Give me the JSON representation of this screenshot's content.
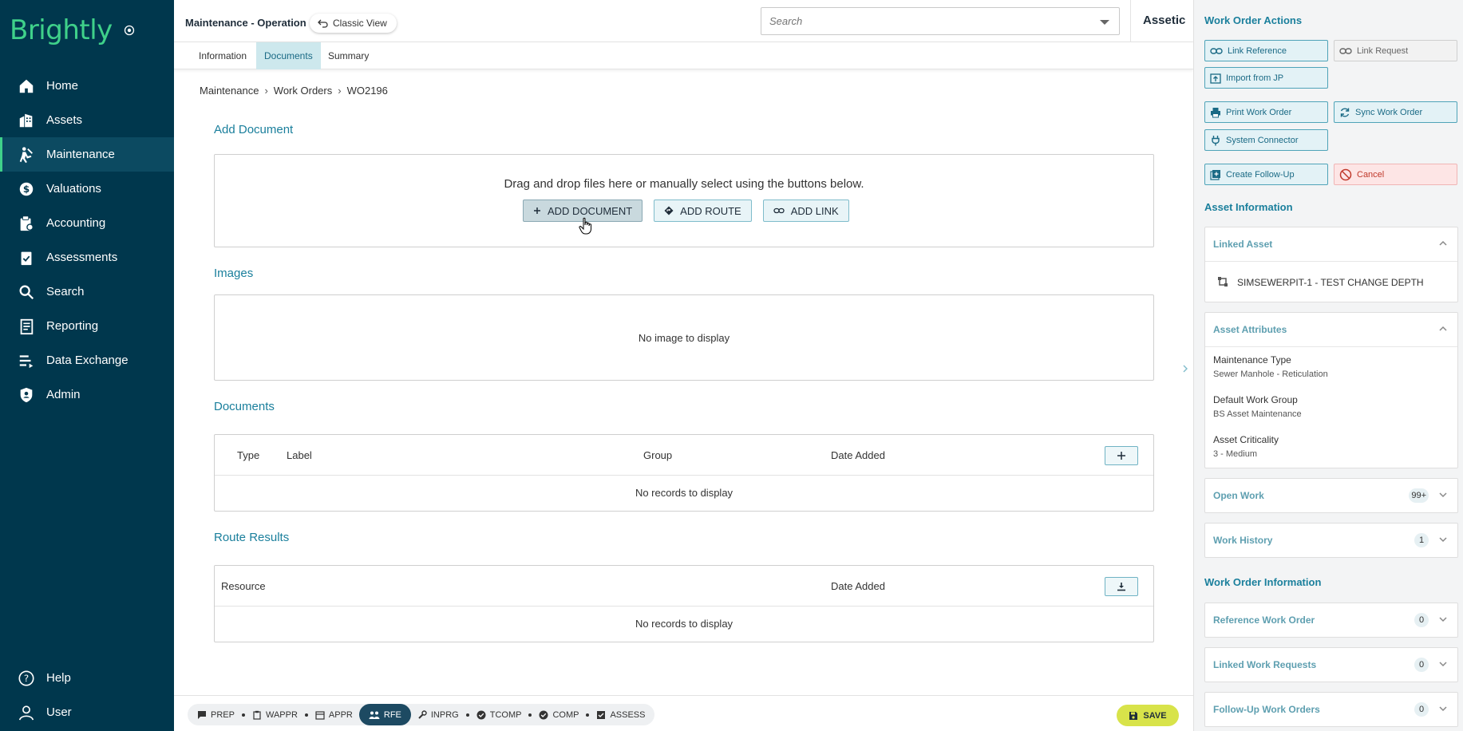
{
  "brand": {
    "logo_text": "Brightly"
  },
  "sidebar": {
    "items": [
      {
        "label": "Home",
        "icon": "home-icon"
      },
      {
        "label": "Assets",
        "icon": "building-icon"
      },
      {
        "label": "Maintenance",
        "icon": "worker-icon",
        "active": true
      },
      {
        "label": "Valuations",
        "icon": "dollar-globe-icon"
      },
      {
        "label": "Accounting",
        "icon": "ledger-icon"
      },
      {
        "label": "Assessments",
        "icon": "clipboard-check-icon"
      },
      {
        "label": "Search",
        "icon": "search-icon"
      },
      {
        "label": "Reporting",
        "icon": "report-icon"
      },
      {
        "label": "Data Exchange",
        "icon": "data-exchange-icon"
      },
      {
        "label": "Admin",
        "icon": "shield-user-icon"
      }
    ],
    "bottom": [
      {
        "label": "Help",
        "icon": "help-icon"
      },
      {
        "label": "User",
        "icon": "user-icon"
      }
    ]
  },
  "header": {
    "title": "Maintenance - Operation",
    "classic_view": "Classic View",
    "search_placeholder": "Search",
    "tenant": "Assetic"
  },
  "tabs": [
    {
      "label": "Information"
    },
    {
      "label": "Documents",
      "active": true
    },
    {
      "label": "Summary"
    }
  ],
  "breadcrumb": [
    "Maintenance",
    "Work Orders",
    "WO2196"
  ],
  "add_document": {
    "title": "Add Document",
    "instructions": "Drag and drop files here or manually select using the buttons below.",
    "buttons": {
      "add_document": "ADD DOCUMENT",
      "add_route": "ADD ROUTE",
      "add_link": "ADD LINK"
    }
  },
  "images": {
    "title": "Images",
    "empty": "No image to display"
  },
  "documents": {
    "title": "Documents",
    "columns": [
      "Type",
      "Label",
      "Group",
      "Date Added"
    ],
    "empty": "No records to display"
  },
  "route_results": {
    "title": "Route Results",
    "columns": [
      "Resource",
      "Date Added"
    ],
    "empty": "No records to display"
  },
  "status_bar": {
    "steps": [
      {
        "label": "PREP",
        "icon": "note-icon"
      },
      {
        "label": "WAPPR",
        "icon": "clipboard-icon"
      },
      {
        "label": "APPR",
        "icon": "calendar-icon"
      },
      {
        "label": "RFE",
        "icon": "people-icon",
        "active": true
      },
      {
        "label": "INPRG",
        "icon": "wrench-icon"
      },
      {
        "label": "TCOMP",
        "icon": "check-circle-icon"
      },
      {
        "label": "COMP",
        "icon": "check-circle-icon"
      },
      {
        "label": "ASSESS",
        "icon": "check-box-icon"
      }
    ],
    "save": "SAVE",
    "save_color": "#d8e34a"
  },
  "right_panel": {
    "actions_title": "Work Order Actions",
    "actions": {
      "link_reference": "Link Reference",
      "link_request": "Link Request",
      "import_from_jp": "Import from JP",
      "print_work_order": "Print Work Order",
      "sync_work_order": "Sync Work Order",
      "system_connector": "System Connector",
      "create_follow_up": "Create Follow-Up",
      "cancel": "Cancel"
    },
    "asset_info_title": "Asset Information",
    "linked_asset": {
      "title": "Linked Asset",
      "value": "SIMSEWERPIT-1 - TEST CHANGE DEPTH"
    },
    "asset_attributes": {
      "title": "Asset Attributes",
      "items": [
        {
          "label": "Maintenance Type",
          "value": "Sewer Manhole - Reticulation"
        },
        {
          "label": "Default Work Group",
          "value": "BS Asset Maintenance"
        },
        {
          "label": "Asset Criticality",
          "value": "3 - Medium"
        }
      ]
    },
    "open_work": {
      "title": "Open Work",
      "count": "99+"
    },
    "work_history": {
      "title": "Work History",
      "count": "1"
    },
    "wo_info_title": "Work Order Information",
    "reference_work_order": {
      "title": "Reference Work Order",
      "count": "0"
    },
    "linked_work_requests": {
      "title": "Linked Work Requests",
      "count": "0"
    },
    "follow_up_work_orders": {
      "title": "Follow-Up Work Orders",
      "count": "0"
    }
  },
  "colors": {
    "sidebar_bg": "#00374d",
    "brand_green": "#3fd18a",
    "accent": "#1a7f9c",
    "danger": "#c0392b"
  }
}
